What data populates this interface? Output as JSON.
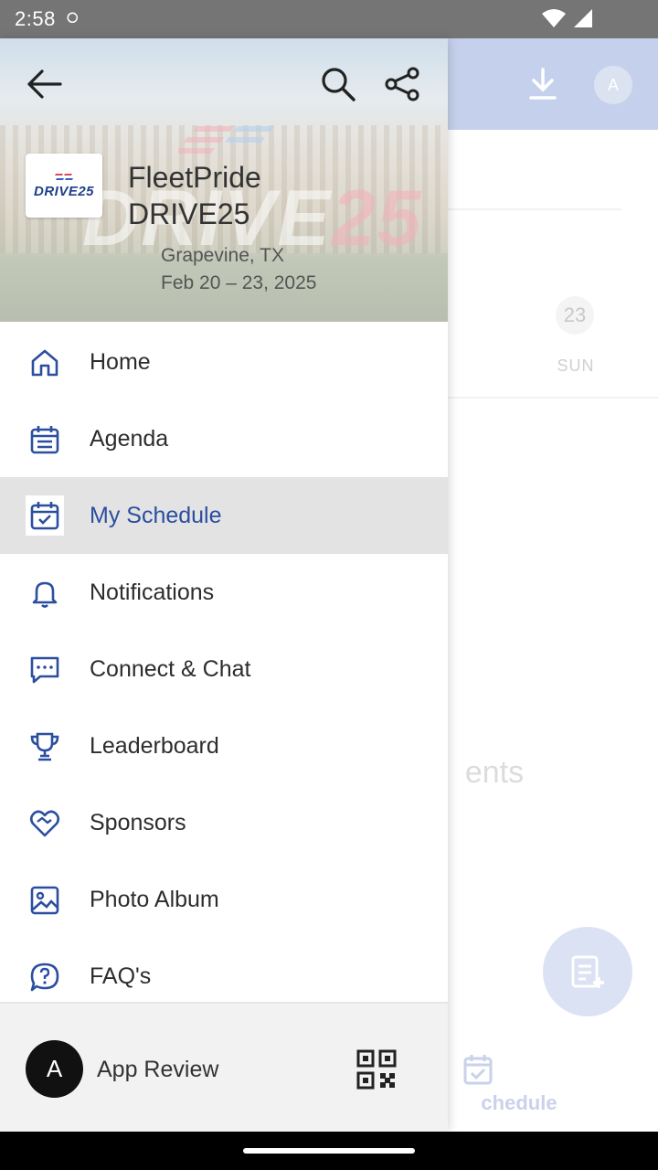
{
  "status_bar": {
    "time": "2:58"
  },
  "background": {
    "avatar_initial": "A",
    "day_number": "23",
    "day_name": "SUN",
    "empty_text_fragment": "ents",
    "tab_label_fragment": "chedule",
    "accent": "#c5d1ec"
  },
  "header": {
    "event_name": "FleetPride DRIVE25",
    "location": "Grapevine, TX",
    "dates": "Feb 20 – 23, 2025",
    "logo_text": "DRIVE25",
    "watermark_main": "DRIVE",
    "watermark_num": "25"
  },
  "menu": {
    "items": [
      {
        "label": "Home",
        "icon": "home-icon"
      },
      {
        "label": "Agenda",
        "icon": "agenda-icon"
      },
      {
        "label": "My Schedule",
        "icon": "calendar-check-icon"
      },
      {
        "label": "Notifications",
        "icon": "bell-icon"
      },
      {
        "label": "Connect & Chat",
        "icon": "chat-icon"
      },
      {
        "label": "Leaderboard",
        "icon": "trophy-icon"
      },
      {
        "label": "Sponsors",
        "icon": "heart-handshake-icon"
      },
      {
        "label": "Photo Album",
        "icon": "image-icon"
      },
      {
        "label": "FAQ's",
        "icon": "question-icon"
      }
    ],
    "active_index": 2
  },
  "footer": {
    "avatar_initial": "A",
    "user_name": "App Review"
  },
  "colors": {
    "primary": "#2b4ea0",
    "active_bg": "#e3e3e3",
    "footer_bg": "#f2f2f2"
  }
}
